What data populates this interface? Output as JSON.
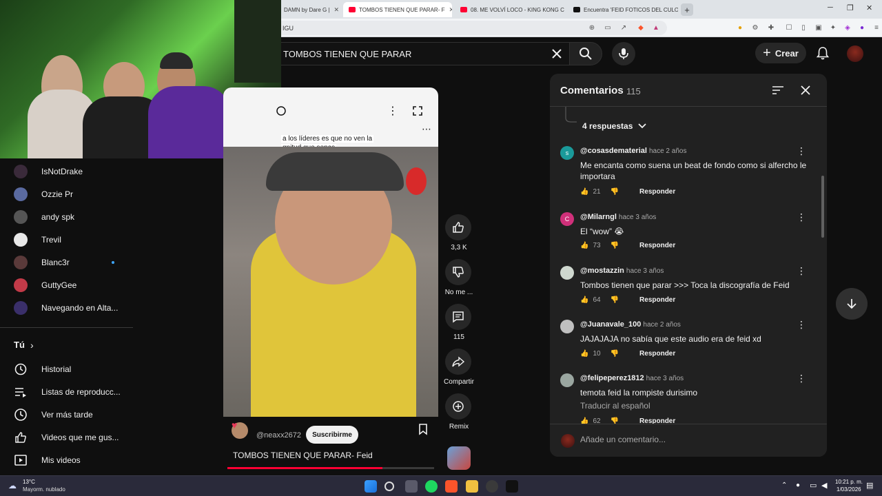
{
  "browser": {
    "tabs": [
      {
        "title": "DAMN by Dare G |"
      },
      {
        "title": "TOMBOS TIENEN QUE PARAR- F"
      },
      {
        "title": "08. ME VOLVÍ LOCO - KING KONG C"
      },
      {
        "title": "Encuentra 'FEID FOTICOS DEL CULO"
      }
    ],
    "url_fragment": "IGU",
    "new_tab": "+"
  },
  "header": {
    "search_query": "TOMBOS TIENEN QUE PARAR",
    "create_label": "Crear"
  },
  "sidebar": {
    "subscriptions": [
      {
        "name": "IsNotDrake",
        "color": "#3a2a3a"
      },
      {
        "name": "Ozzie Pr",
        "color": "#5a6aa0"
      },
      {
        "name": "andy spk",
        "color": "#555"
      },
      {
        "name": "Trevil",
        "color": "#e8e8e8"
      },
      {
        "name": "Blanc3r",
        "color": "#5a3a3a"
      },
      {
        "name": "GuttyGee",
        "color": "#c23a48"
      },
      {
        "name": "Navegando en Alta...",
        "color": "#3a2f6a"
      }
    ],
    "you_label": "Tú",
    "you_chevron": "›",
    "you_items": [
      {
        "label": "Historial",
        "icon": "history-icon"
      },
      {
        "label": "Listas de reproducc...",
        "icon": "playlist-icon"
      },
      {
        "label": "Ver más tarde",
        "icon": "clock-icon"
      },
      {
        "label": "Videos que me gus...",
        "icon": "like-icon"
      },
      {
        "label": "Mis videos",
        "icon": "video-icon"
      }
    ]
  },
  "video": {
    "caption_line1": "a los líderes es que no ven la",
    "caption_line2": "gnitud que sepas",
    "channel": "@neaxx2672",
    "subscribe_label": "Suscribirme",
    "title": "TOMBOS TIENEN QUE PARAR- Feid",
    "progress": 0.75
  },
  "actions": {
    "likes": "3,3 K",
    "dislike_label": "No me ...",
    "comments": "115",
    "share_label": "Compartir",
    "remix_label": "Remix"
  },
  "comments": {
    "title": "Comentarios",
    "count": "115",
    "replies_label": "4 respuestas",
    "reply_label": "Responder",
    "placeholder": "Añade un comentario...",
    "items": [
      {
        "author": "@cosasdematerial",
        "time": "hace 2 años",
        "text": "Me encanta como suena un beat de fondo como si alfercho le importara",
        "likes": "21",
        "initial": "s",
        "color": "#1a9a9a"
      },
      {
        "author": "@Milarngl",
        "time": "hace 3 años",
        "text": "El “wow” 😭",
        "likes": "73",
        "initial": "C",
        "color": "#d0307a"
      },
      {
        "author": "@mostazzin",
        "time": "hace 3 años",
        "text": "Tombos tienen que parar >>> Toca la discografía de Feid",
        "likes": "64",
        "initial": "",
        "color": "#cfd8cf"
      },
      {
        "author": "@Juanavale_100",
        "time": "hace 2 años",
        "text": "JAJAJAJA no sabía que este audio era de feid xd",
        "likes": "10",
        "initial": "",
        "color": "#bfbfbf"
      },
      {
        "author": "@felipeperez1812",
        "time": "hace 3 años",
        "text": "temota feid la rompiste durisimo",
        "likes": "62",
        "initial": "",
        "color": "#9aa6a0"
      }
    ],
    "translate_label": "Traducir al español"
  },
  "taskbar": {
    "temperature": "13°C",
    "weather": "Mayorm. nublado",
    "time": "10:21 p. m.",
    "date": "1/03/2026"
  }
}
